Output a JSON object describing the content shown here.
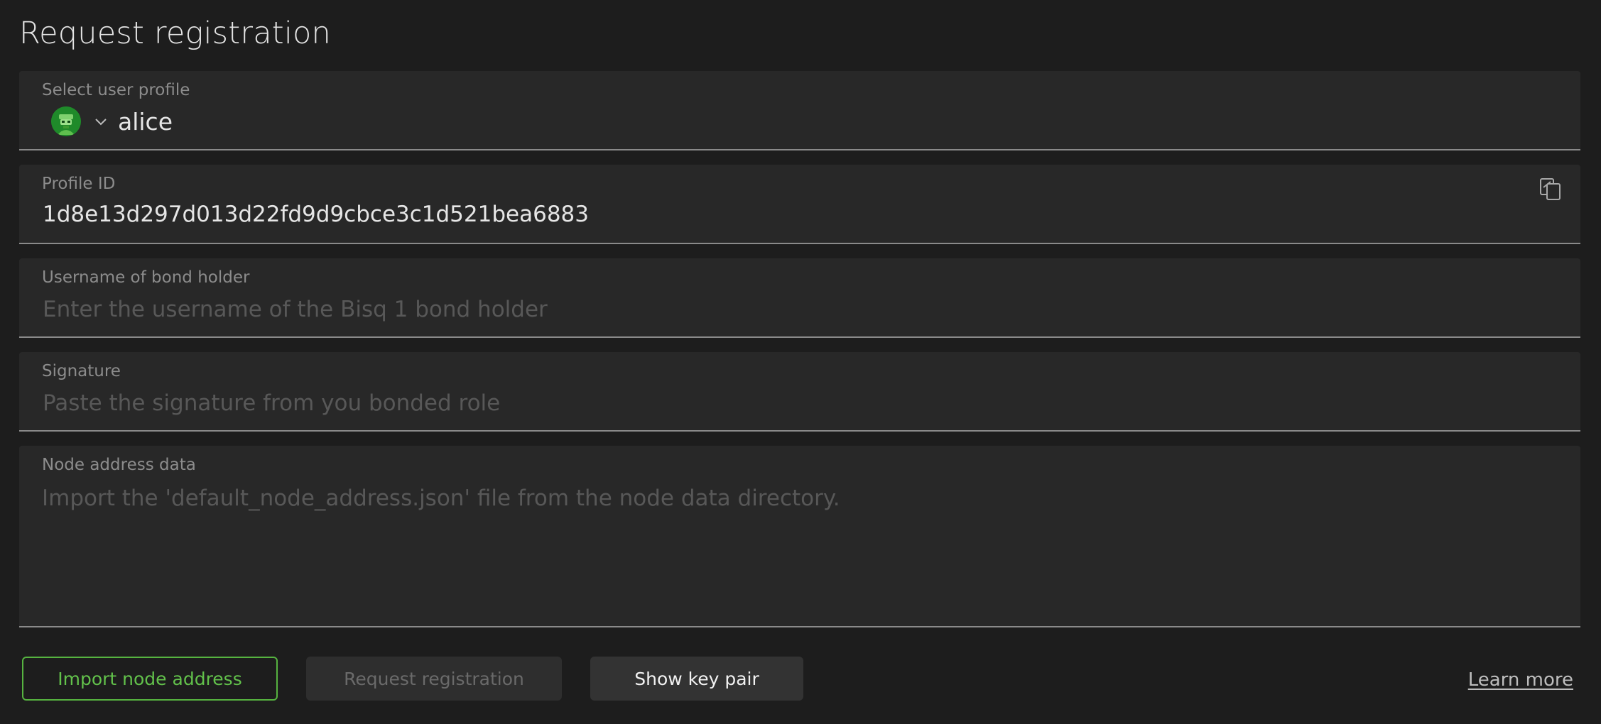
{
  "page": {
    "title": "Request registration"
  },
  "profile_select": {
    "label": "Select user profile",
    "value": "alice",
    "avatar_icon": "robot-avatar-icon",
    "chevron_icon": "chevron-down-icon"
  },
  "profile_id": {
    "label": "Profile ID",
    "value": "1d8e13d297d013d22fd9d9cbce3c1d521bea6883",
    "copy_icon": "copy-icon"
  },
  "bond_holder": {
    "label": "Username of bond holder",
    "placeholder": "Enter the username of the Bisq 1 bond holder",
    "value": ""
  },
  "signature": {
    "label": "Signature",
    "placeholder": "Paste the signature from you bonded role",
    "value": ""
  },
  "node_address": {
    "label": "Node address data",
    "placeholder": "Import the 'default_node_address.json' file from the node data directory.",
    "value": ""
  },
  "actions": {
    "import_label": "Import node address",
    "request_label": "Request registration",
    "keypair_label": "Show key pair",
    "learn_more_label": "Learn more"
  },
  "colors": {
    "background": "#1d1d1d",
    "field_background": "#282828",
    "accent_green": "#56b340",
    "text_primary": "#e6e6e6",
    "text_muted": "#8c8c8c",
    "placeholder": "#585858"
  }
}
